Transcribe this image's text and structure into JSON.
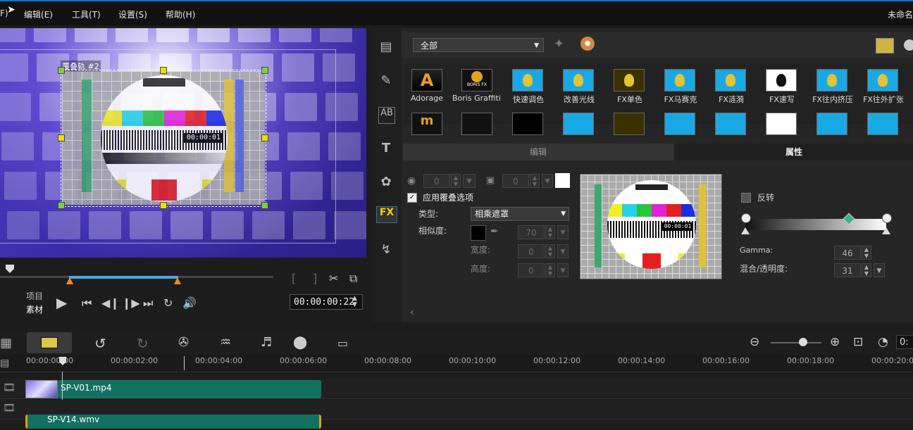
{
  "menu": {
    "file_partial": "F)",
    "edit": "编辑(E)",
    "tools": "工具(T)",
    "settings": "设置(S)",
    "help": "帮助(H)",
    "title_partial": "未命名"
  },
  "preview": {
    "overlay_label": "覆叠轨 #2",
    "card_timecode": "00:00:01"
  },
  "transport": {
    "mode_project": "项目",
    "mode_clip": "素材",
    "timecode": "00:00:00:22"
  },
  "filters": {
    "category": "全部",
    "items": [
      {
        "label": "Adorage"
      },
      {
        "label": "Boris Graffiti ..."
      },
      {
        "label": "快速调色"
      },
      {
        "label": "改善光线"
      },
      {
        "label": "FX单色"
      },
      {
        "label": "FX马赛克"
      },
      {
        "label": "FX涟漪"
      },
      {
        "label": "FX速写"
      },
      {
        "label": "FX往内挤压"
      },
      {
        "label": "FX往外扩张"
      }
    ],
    "boris_badge": "BORIS FX"
  },
  "tabs": {
    "edit": "编辑",
    "attributes": "属性"
  },
  "attrs": {
    "spin1": "0",
    "spin2": "0",
    "apply_overlay": "应用覆叠选项",
    "type_label": "类型:",
    "type_value": "相乘遮罩",
    "similarity_label": "相似度:",
    "similarity_value": "70",
    "width_label": "宽度:",
    "width_value": "0",
    "height_label": "高度:",
    "height_value": "0",
    "invert_label": "反转",
    "gamma_label": "Gamma:",
    "gamma_value": "46",
    "blend_label": "混合/透明度:",
    "blend_value": "31",
    "preview_timecode": "00:00:01"
  },
  "timeline": {
    "ticks": [
      "00:00:00:00",
      "00:00:02:00",
      "00:00:04:00",
      "00:00:06:00",
      "00:00:08:00",
      "00:00:10:00",
      "00:00:12:00",
      "00:00:14:00",
      "00:00:16:00",
      "00:00:18:00",
      "00:00:20:00"
    ],
    "clip1": "SP-V01.mp4",
    "clip2": "SP-V14.wmv",
    "zoom_field": "0:"
  }
}
